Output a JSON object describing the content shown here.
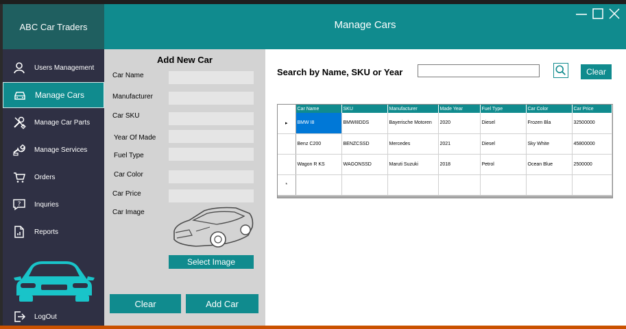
{
  "brand": {
    "name": "ABC Car Traders"
  },
  "header": {
    "title": "Manage Cars"
  },
  "window_controls": [
    "minimize-icon",
    "maximize-icon",
    "close-icon"
  ],
  "sidebar": {
    "items": [
      {
        "label": "Users Management",
        "icon": "user-icon"
      },
      {
        "label": "Manage Cars",
        "icon": "car-icon",
        "active": true
      },
      {
        "label": "Manage Car Parts",
        "icon": "tools-icon"
      },
      {
        "label": "Manage Services",
        "icon": "wrench-icon"
      },
      {
        "label": "Orders",
        "icon": "cart-icon"
      },
      {
        "label": "Inquries",
        "icon": "chat-icon"
      },
      {
        "label": "Reports",
        "icon": "report-icon"
      }
    ],
    "logout": {
      "label": "LogOut",
      "icon": "logout-icon"
    }
  },
  "form": {
    "title": "Add New Car",
    "fields": {
      "car_name": {
        "label": "Car Name",
        "value": ""
      },
      "manufacturer": {
        "label": "Manufacturer",
        "value": ""
      },
      "car_sku": {
        "label": "Car SKU",
        "value": ""
      },
      "year_of_made": {
        "label": "Year Of Made",
        "value": ""
      },
      "fuel_type": {
        "label": "Fuel Type",
        "value": ""
      },
      "car_color": {
        "label": "Car Color",
        "value": ""
      },
      "car_price": {
        "label": "Car Price",
        "value": ""
      }
    },
    "image_label": "Car Image",
    "select_image": "Select Image",
    "clear": "Clear",
    "add": "Add Car"
  },
  "search": {
    "label": "Search by Name, SKU or Year",
    "value": "",
    "clear": "Clear"
  },
  "table": {
    "columns": [
      "Car Name",
      "SKU",
      "Manufacturer",
      "Made Year",
      "Fuel Type",
      "Car Color",
      "Car Price"
    ],
    "rows": [
      [
        "BMW I8",
        "BMWI8DDS",
        "Bayerische Motoren",
        "2020",
        "Diesel",
        "Frozen Bla",
        "32500000"
      ],
      [
        "Benz C200",
        "BENZCSSD",
        "Mercedes",
        "2021",
        "Diesel",
        "Sky White",
        "45800000"
      ],
      [
        "Wagon R KS",
        "WAGONSSD",
        "Maruti Suzuki",
        "2018",
        "Petrol",
        "Ocean Blue",
        "2500000"
      ]
    ],
    "current_row_marker": "▸",
    "new_row_marker": "*"
  },
  "colors": {
    "primary": "#108b8e",
    "brand_bg": "#1f5f60",
    "sidebar_bg": "#2f3044",
    "form_bg": "#d3d3d3",
    "selection": "#0078d7"
  }
}
